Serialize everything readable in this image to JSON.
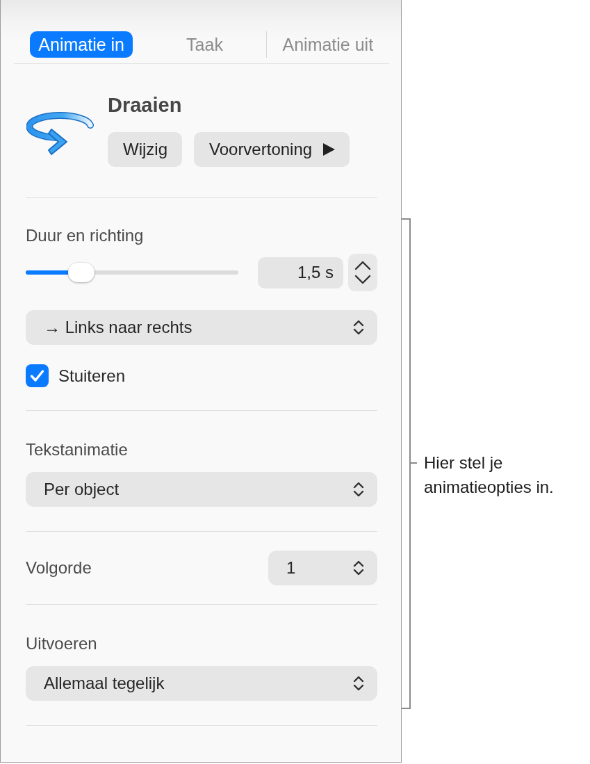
{
  "tabs": [
    {
      "label": "Animatie in",
      "selected": true
    },
    {
      "label": "Taak",
      "selected": false
    },
    {
      "label": "Animatie uit",
      "selected": false
    }
  ],
  "effect": {
    "title": "Draaien",
    "buttons": [
      {
        "kind": "plain",
        "label": "Wijzig"
      },
      {
        "kind": "preview",
        "label": "Voorvertoning"
      }
    ]
  },
  "duration": {
    "heading": "Duur en richting",
    "slider": {
      "level": 0.26
    },
    "value": "1,5 s",
    "direction": "→ Links naar rechts",
    "bounce": {
      "label": "Stuiteren",
      "checked": true
    }
  },
  "text_animation": {
    "heading": "Tekstanimatie",
    "value": "Per object"
  },
  "order": {
    "heading": "Volgorde",
    "value": "1"
  },
  "delivery": {
    "heading": "Uitvoeren",
    "value": "Allemaal tegelijk"
  },
  "callout": {
    "text": "Hier stel je animatieopties in."
  }
}
